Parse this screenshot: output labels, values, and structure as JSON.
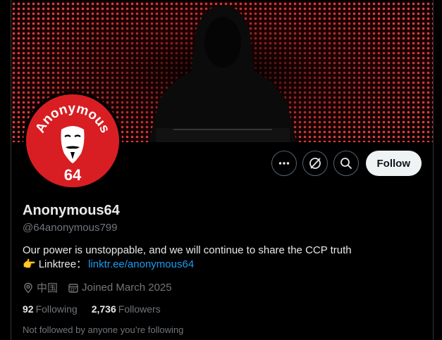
{
  "profile": {
    "display_name": "Anonymous64",
    "handle": "@64anonymous799",
    "bio_line1": "Our power is unstoppable, and we will continue to share the CCP truth",
    "bio_prefix": "Linktree：",
    "bio_link": "linktr.ee/anonymous64",
    "location": "中国",
    "joined": "Joined March 2025",
    "following_count": "92",
    "following_label": "Following",
    "followers_count": "2,736",
    "followers_label": "Followers",
    "not_followed": "Not followed by anyone you’re following"
  },
  "avatar": {
    "arc_text": "Anonymous",
    "number": "64"
  },
  "actions": {
    "more_icon": "more-icon",
    "grok_icon": "grok-icon",
    "search_icon": "search-icon",
    "follow_label": "Follow"
  },
  "colors": {
    "background": "#000000",
    "accent_link": "#1d9bf0",
    "avatar_red": "#d81e22",
    "muted": "#71767b"
  }
}
